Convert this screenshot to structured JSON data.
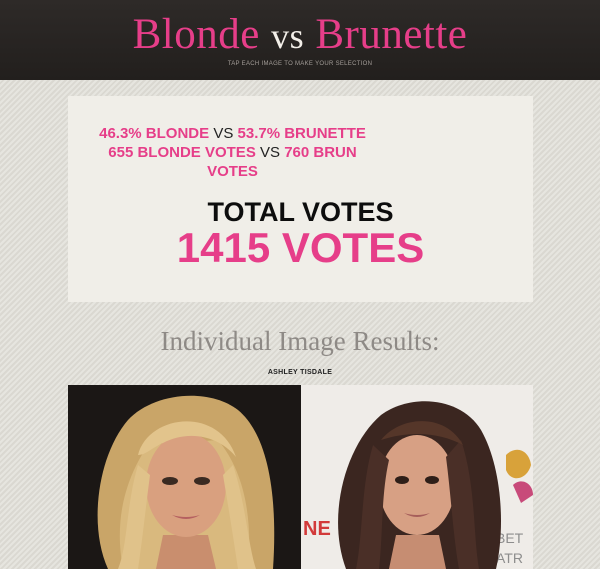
{
  "header": {
    "title_left": "Blonde",
    "title_vs": "vs",
    "title_right": "Brunette",
    "subtitle": "TAP EACH IMAGE TO MAKE YOUR SELECTION"
  },
  "results": {
    "blonde_percent": "46.3% BLONDE",
    "vs_1": "VS",
    "brunette_percent": "53.7% BRUNETTE",
    "blonde_votes": "655 BLONDE VOTES",
    "vs_2": "VS",
    "brunette_votes": "760 BRUN",
    "brunette_votes_cont": "VOTES",
    "total_label": "TOTAL VOTES",
    "total_value": "1415 VOTES"
  },
  "individual": {
    "heading": "Individual Image Results:",
    "person_name": "ASHLEY TISDALE",
    "backdrop_text": [
      "NE",
      "BET",
      "ATR"
    ]
  },
  "colors": {
    "accent_pink": "#e63e89",
    "header_bg": "#2a2624",
    "panel_bg": "#f0eee8",
    "page_bg": "#e1dfd8"
  }
}
